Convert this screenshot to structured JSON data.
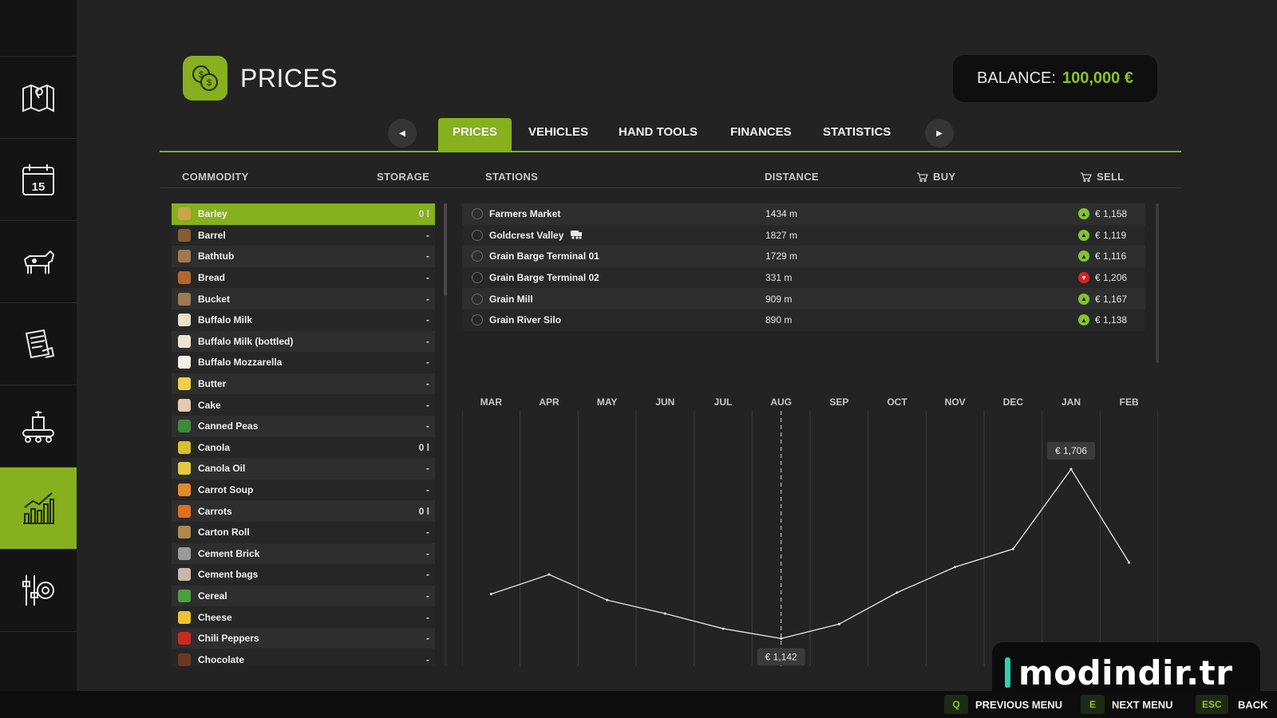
{
  "header": {
    "title": "PRICES",
    "balance_label": "BALANCE:",
    "balance_value": "100,000 €"
  },
  "colors": {
    "accent": "#86b01e",
    "balance": "#8bc425",
    "trend_up": "#86c22a",
    "trend_down": "#e02020",
    "watermark_bar": "#2ecfb0"
  },
  "sidebar": {
    "items": [
      {
        "icon": "map-icon"
      },
      {
        "icon": "calendar-icon",
        "text": "15"
      },
      {
        "icon": "cow-icon"
      },
      {
        "icon": "contracts-icon"
      },
      {
        "icon": "production-icon"
      },
      {
        "icon": "prices-chart-icon",
        "active": true
      },
      {
        "icon": "settings-icon"
      }
    ]
  },
  "tabs": [
    {
      "label": "PRICES",
      "active": true
    },
    {
      "label": "VEHICLES"
    },
    {
      "label": "HAND TOOLS"
    },
    {
      "label": "FINANCES"
    },
    {
      "label": "STATISTICS"
    }
  ],
  "columns": {
    "commodity": "COMMODITY",
    "storage": "STORAGE",
    "stations": "STATIONS",
    "distance": "DISTANCE",
    "buy": "BUY",
    "sell": "SELL"
  },
  "commodities": [
    {
      "name": "Barley",
      "storage": "0 l",
      "selected": true,
      "icon_color": "#c9a646"
    },
    {
      "name": "Barrel",
      "storage": "-",
      "icon_color": "#8a5a32"
    },
    {
      "name": "Bathtub",
      "storage": "-",
      "icon_color": "#a07850"
    },
    {
      "name": "Bread",
      "storage": "-",
      "icon_color": "#b5672b"
    },
    {
      "name": "Bucket",
      "storage": "-",
      "icon_color": "#9b7a55"
    },
    {
      "name": "Buffalo Milk",
      "storage": "-",
      "icon_color": "#e8e0c8"
    },
    {
      "name": "Buffalo Milk (bottled)",
      "storage": "-",
      "icon_color": "#ece6d0"
    },
    {
      "name": "Buffalo Mozzarella",
      "storage": "-",
      "icon_color": "#f2f0e6"
    },
    {
      "name": "Butter",
      "storage": "-",
      "icon_color": "#f0d048"
    },
    {
      "name": "Cake",
      "storage": "-",
      "icon_color": "#e8c8b0"
    },
    {
      "name": "Canned Peas",
      "storage": "-",
      "icon_color": "#3c8a3c"
    },
    {
      "name": "Canola",
      "storage": "0 l",
      "icon_color": "#d6c030"
    },
    {
      "name": "Canola Oil",
      "storage": "-",
      "icon_color": "#e4c840"
    },
    {
      "name": "Carrot Soup",
      "storage": "-",
      "icon_color": "#e08a2a"
    },
    {
      "name": "Carrots",
      "storage": "0 l",
      "icon_color": "#e0701e"
    },
    {
      "name": "Carton Roll",
      "storage": "-",
      "icon_color": "#b08850"
    },
    {
      "name": "Cement Brick",
      "storage": "-",
      "icon_color": "#9a9a9a"
    },
    {
      "name": "Cement bags",
      "storage": "-",
      "icon_color": "#c8b8a8"
    },
    {
      "name": "Cereal",
      "storage": "-",
      "icon_color": "#4aa040"
    },
    {
      "name": "Cheese",
      "storage": "-",
      "icon_color": "#f0c030"
    },
    {
      "name": "Chili Peppers",
      "storage": "-",
      "icon_color": "#c82a1e"
    },
    {
      "name": "Chocolate",
      "storage": "-",
      "icon_color": "#6a3a1e"
    }
  ],
  "stations": [
    {
      "name": "Farmers Market",
      "distance": "1434 m",
      "trend": "up",
      "sell": "€ 1,158"
    },
    {
      "name": "Goldcrest Valley",
      "distance": "1827 m",
      "trend": "up",
      "sell": "€ 1,119",
      "train_icon": true
    },
    {
      "name": "Grain Barge Terminal 01",
      "distance": "1729 m",
      "trend": "up",
      "sell": "€ 1,116"
    },
    {
      "name": "Grain Barge Terminal 02",
      "distance": "331 m",
      "trend": "down",
      "sell": "€ 1,206"
    },
    {
      "name": "Grain Mill",
      "distance": "909 m",
      "trend": "up",
      "sell": "€ 1,167"
    },
    {
      "name": "Grain River Silo",
      "distance": "890 m",
      "trend": "up",
      "sell": "€ 1,138"
    }
  ],
  "chart_data": {
    "type": "line",
    "categories": [
      "MAR",
      "APR",
      "MAY",
      "JUN",
      "JUL",
      "AUG",
      "SEP",
      "OCT",
      "NOV",
      "DEC",
      "JAN",
      "FEB"
    ],
    "series": [
      {
        "values": [
          1290,
          1355,
          1270,
          1225,
          1175,
          1142,
          1190,
          1295,
          1380,
          1440,
          1706,
          1395
        ]
      }
    ],
    "ylim": [
      1050,
      1900
    ],
    "labels": [
      {
        "index": 5,
        "text": "€ 1,142"
      },
      {
        "index": 10,
        "text": "€ 1,706"
      }
    ],
    "highlight_index": 5,
    "grid": true
  },
  "watermark": {
    "text": "modindir.tr"
  },
  "footer": [
    {
      "key": "Q",
      "label": "PREVIOUS MENU"
    },
    {
      "key": "E",
      "label": "NEXT MENU"
    },
    {
      "key": "ESC",
      "label": "BACK"
    }
  ]
}
